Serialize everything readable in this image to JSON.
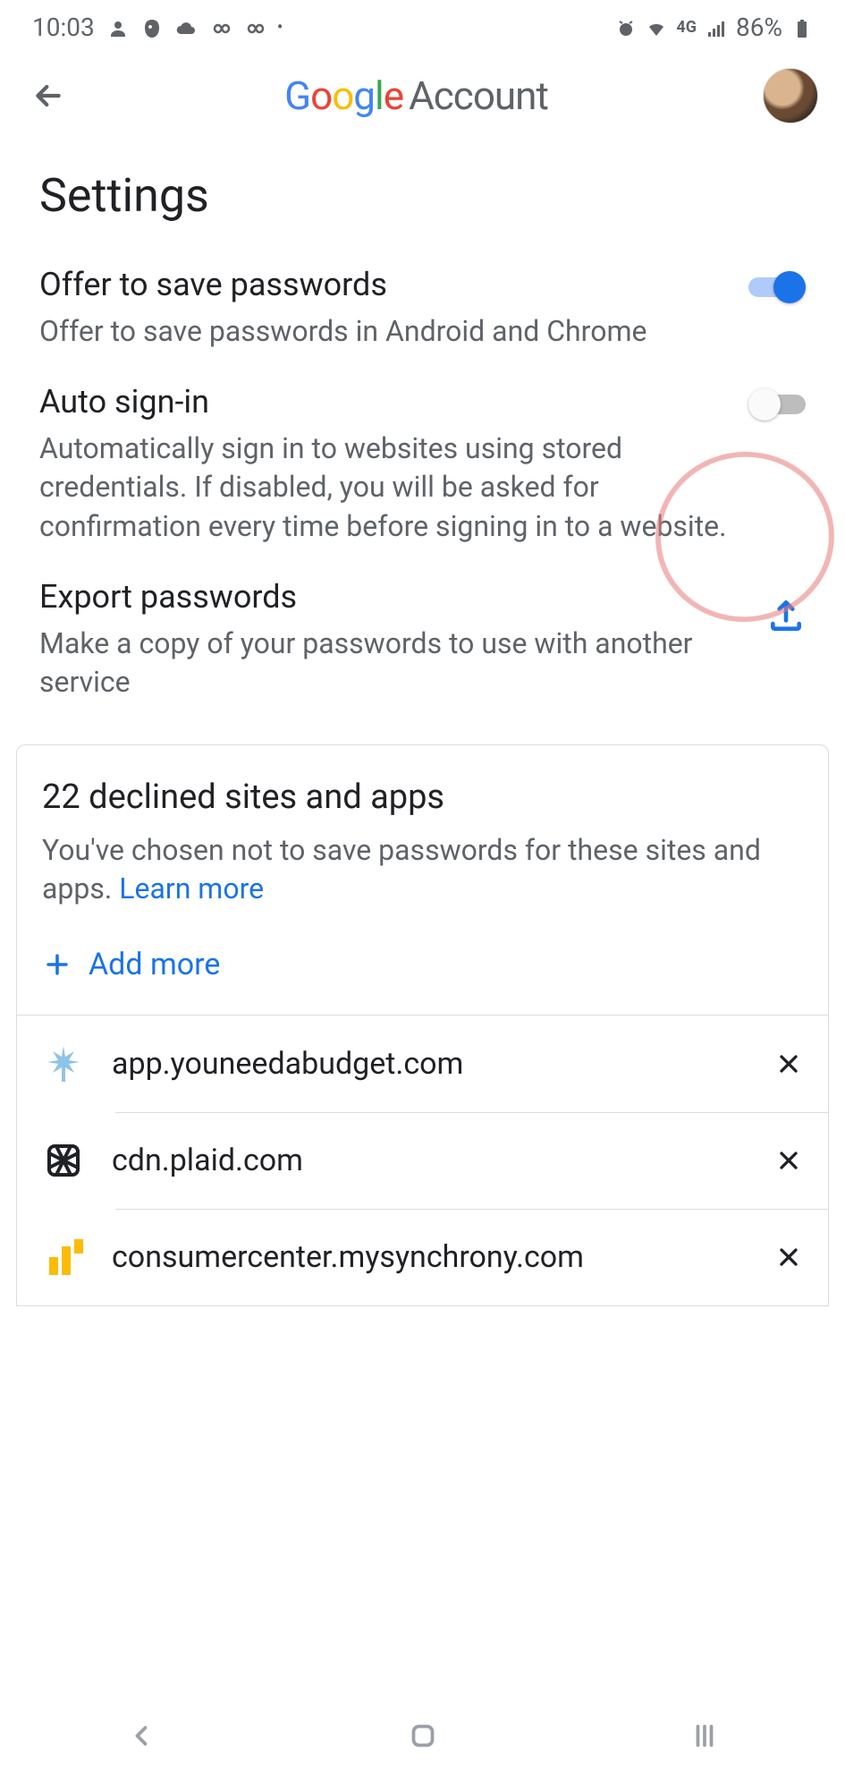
{
  "status": {
    "time": "10:03",
    "network": "4G",
    "battery": "86%"
  },
  "header": {
    "brand_google": "Google",
    "brand_account": "Account"
  },
  "page": {
    "title": "Settings"
  },
  "settings": {
    "save_passwords": {
      "title": "Offer to save passwords",
      "desc": "Offer to save passwords in Android and Chrome",
      "enabled": true
    },
    "auto_signin": {
      "title": "Auto sign-in",
      "desc": "Automatically sign in to websites using stored credentials. If disabled, you will be asked for confirmation every time before signing in to a website.",
      "enabled": false
    },
    "export": {
      "title": "Export passwords",
      "desc": "Make a copy of your passwords to use with another service"
    }
  },
  "declined": {
    "title": "22 declined sites and apps",
    "desc": "You've chosen not to save passwords for these sites and apps. ",
    "learn_more": "Learn more",
    "add_more": "Add more",
    "sites": [
      {
        "name": "app.youneedabudget.com"
      },
      {
        "name": "cdn.plaid.com"
      },
      {
        "name": "consumercenter.mysynchrony.com"
      }
    ]
  }
}
